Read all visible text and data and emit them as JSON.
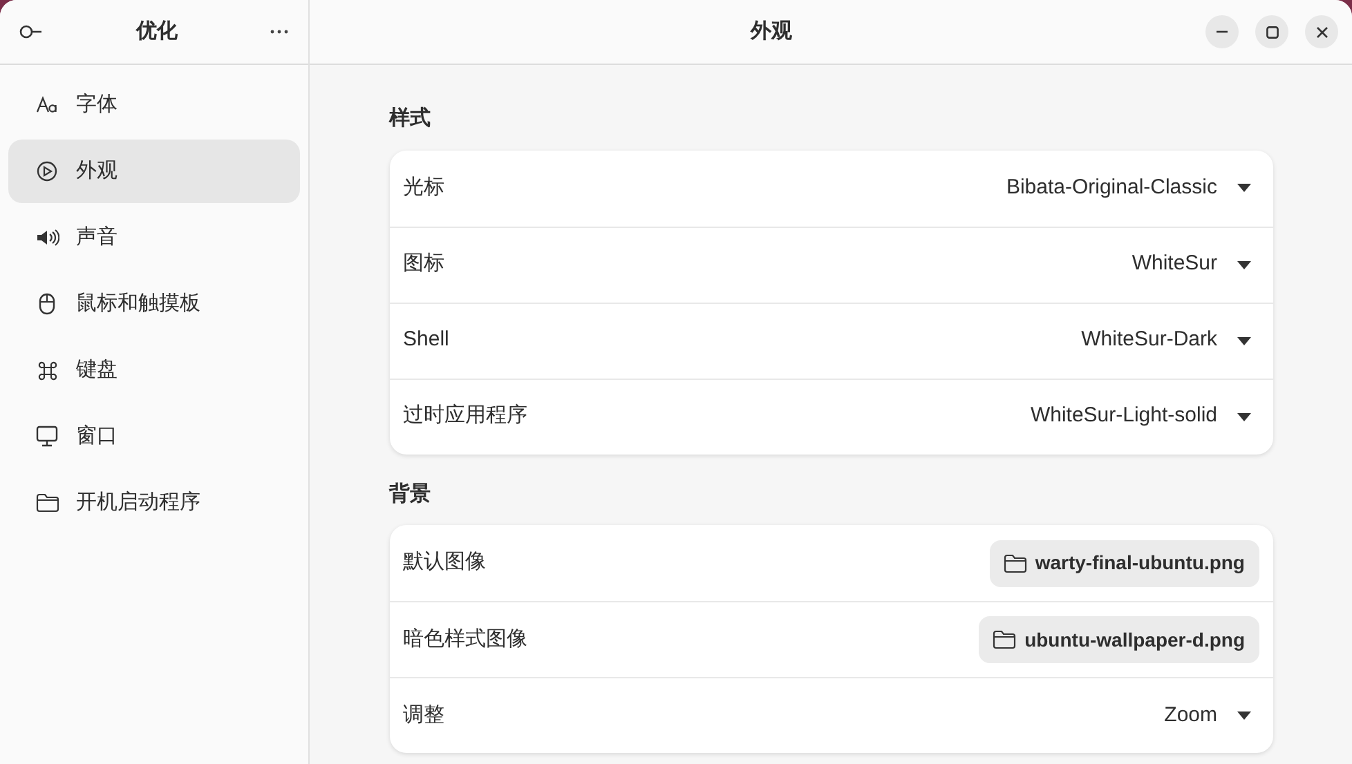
{
  "sidebar": {
    "title": "优化",
    "items": [
      {
        "label": "字体",
        "selected": false
      },
      {
        "label": "外观",
        "selected": true
      },
      {
        "label": "声音",
        "selected": false
      },
      {
        "label": "鼠标和触摸板",
        "selected": false
      },
      {
        "label": "键盘",
        "selected": false
      },
      {
        "label": "窗口",
        "selected": false
      },
      {
        "label": "开机启动程序",
        "selected": false
      }
    ]
  },
  "window": {
    "title": "外观"
  },
  "sections": [
    {
      "title": "样式",
      "rows": [
        {
          "kind": "dropdown",
          "label": "光标",
          "value": "Bibata-Original-Classic"
        },
        {
          "kind": "dropdown",
          "label": "图标",
          "value": "WhiteSur"
        },
        {
          "kind": "dropdown",
          "label": "Shell",
          "value": "WhiteSur-Dark"
        },
        {
          "kind": "dropdown",
          "label": "过时应用程序",
          "value": "WhiteSur-Light-solid"
        }
      ]
    },
    {
      "title": "背景",
      "rows": [
        {
          "kind": "file",
          "label": "默认图像",
          "value": "warty-final-ubuntu.png"
        },
        {
          "kind": "file",
          "label": "暗色样式图像",
          "value": "ubuntu-wallpaper-d.png"
        },
        {
          "kind": "dropdown",
          "label": "调整",
          "value": "Zoom"
        }
      ]
    }
  ]
}
